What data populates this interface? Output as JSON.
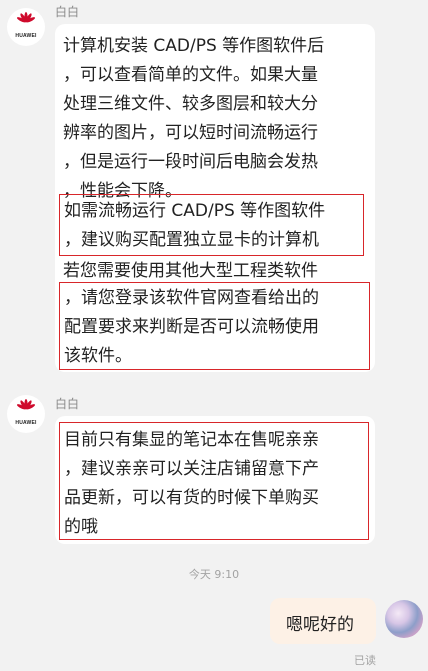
{
  "brand_text": "HUAWEI",
  "colors": {
    "background": "#f2f2f2",
    "bubble": "#ffffff",
    "highlight_border": "#d8262a",
    "own_bubble": "#fdf1e6",
    "brand_red": "#cf0a2c"
  },
  "messages": [
    {
      "sender": "白白",
      "paragraphs": [
        "计算机安装 CAD/PS 等作图软件后\n，可以查看简单的文件。如果大量\n处理三维文件、较多图层和较大分\n辨率的图片，可以短时间流畅运行\n，但是运行一段时间后电脑会发热\n，性能会下降。",
        "如需流畅运行 CAD/PS 等作图软件\n，建议购买配置独立显卡的计算机",
        "若您需要使用其他大型工程类软件",
        "，请您登录该软件官网查看给出的\n配置要求来判断是否可以流畅使用\n该软件。"
      ]
    },
    {
      "sender": "白白",
      "paragraphs": [
        "目前只有集显的笔记本在售呢亲亲\n，建议亲亲可以关注店铺留意下产\n品更新，可以有货的时候下单购买\n的哦"
      ]
    }
  ],
  "timestamp": "今天 9:10",
  "own_message": {
    "text": "嗯呢好的",
    "status": "已读"
  }
}
